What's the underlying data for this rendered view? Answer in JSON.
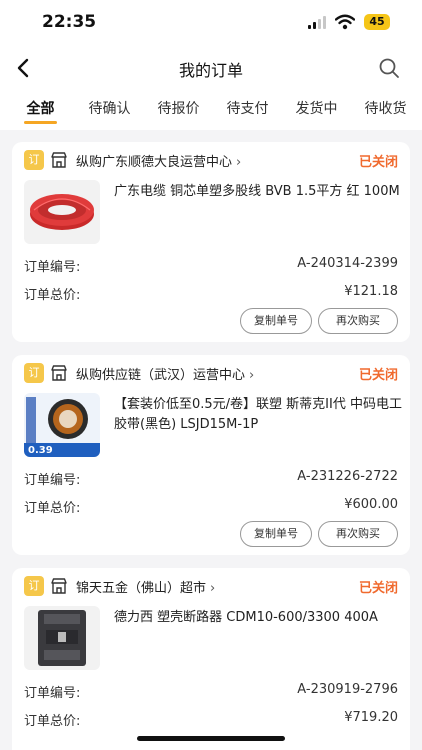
{
  "status_bar": {
    "time": "22:35",
    "battery": "45"
  },
  "header": {
    "title": "我的订单"
  },
  "tabs": [
    {
      "label": "全部",
      "active": true
    },
    {
      "label": "待确认"
    },
    {
      "label": "待报价"
    },
    {
      "label": "待支付"
    },
    {
      "label": "发货中"
    },
    {
      "label": "待收货"
    }
  ],
  "labels": {
    "order_no": "订单编号:",
    "total": "订单总价:",
    "copy_button": "复制单号",
    "rebuy_button": "再次购买",
    "store_badge": "订"
  },
  "orders": [
    {
      "store": "纵购广东顺德大良运营中心",
      "status": "已关闭",
      "product": "广东电缆 铜芯单塑多股线 BVB 1.5平方 红 100M",
      "order_no": "A-240314-2399",
      "total": "¥121.18",
      "thumb": "red-cable"
    },
    {
      "store": "纵购供应链（武汉）运营中心",
      "status": "已关闭",
      "product": "【套装价低至0.5元/卷】联塑 斯蒂克II代 中码电工胶带(黑色) LSJD15M-1P",
      "order_no": "A-231226-2722",
      "total": "¥600.00",
      "thumb": "tape",
      "thumb_price": "0.39"
    },
    {
      "store": "锦天五金（佛山）超市",
      "status": "已关闭",
      "product": "德力西 塑壳断路器 CDM10-600/3300 400A",
      "order_no": "A-230919-2796",
      "total": "¥719.20",
      "thumb": "breaker"
    }
  ],
  "colors": {
    "accent": "#f5a623",
    "status_closed": "#f06a2e",
    "badge": "#f5c74a"
  }
}
